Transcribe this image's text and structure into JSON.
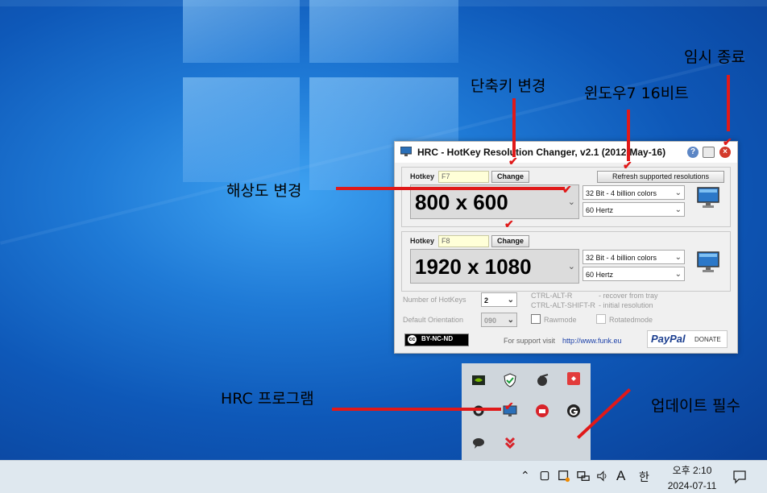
{
  "window": {
    "title": "HRC - HotKey Resolution Changer, v2.1 (2012-May-16)",
    "group1": {
      "hotkey_label": "Hotkey",
      "hotkey_value": "F7",
      "change_label": "Change",
      "refresh_label": "Refresh supported resolutions",
      "resolution": "800 x 600",
      "color_depth": "32 Bit - 4 billion colors",
      "refresh_rate": "60 Hertz"
    },
    "group2": {
      "hotkey_label": "Hotkey",
      "hotkey_value": "F8",
      "change_label": "Change",
      "resolution": "1920 x 1080",
      "color_depth": "32 Bit - 4 billion colors",
      "refresh_rate": "60 Hertz"
    },
    "settings": {
      "num_hotkeys_label": "Number of HotKeys",
      "num_hotkeys_value": "2",
      "orientation_label": "Default Orientation",
      "orientation_value": "090",
      "shortcut1_key": "CTRL-ALT-R",
      "shortcut1_desc": "- recover from tray",
      "shortcut2_key": "CTRL-ALT-SHIFT-R",
      "shortcut2_desc": "- initial resolution",
      "rawmode_label": "Rawmode",
      "rotatedmode_label": "Rotatedmode"
    },
    "footer": {
      "license": "BY-NC-ND",
      "support_text": "For support visit",
      "support_link": "http://www.funk.eu",
      "paypal_label": "PayPal",
      "donate_label": "DONATE"
    }
  },
  "taskbar": {
    "ime_mode": "A",
    "ime_lang": "한",
    "time": "오후 2:10",
    "date": "2024-07-11"
  },
  "annotations": {
    "temp_exit": "임시 종료",
    "shortcut_change": "단축키 변경",
    "win7_16bit": "윈도우7 16비트",
    "resolution_change": "해상도 변경",
    "hrc_program": "HRC 프로그램",
    "update_required": "업데이트 필수"
  },
  "colors": {
    "annotation_red": "#e01919",
    "hotkey_field_bg": "#ffffd8",
    "desktop_blue": "#0e58b8"
  }
}
